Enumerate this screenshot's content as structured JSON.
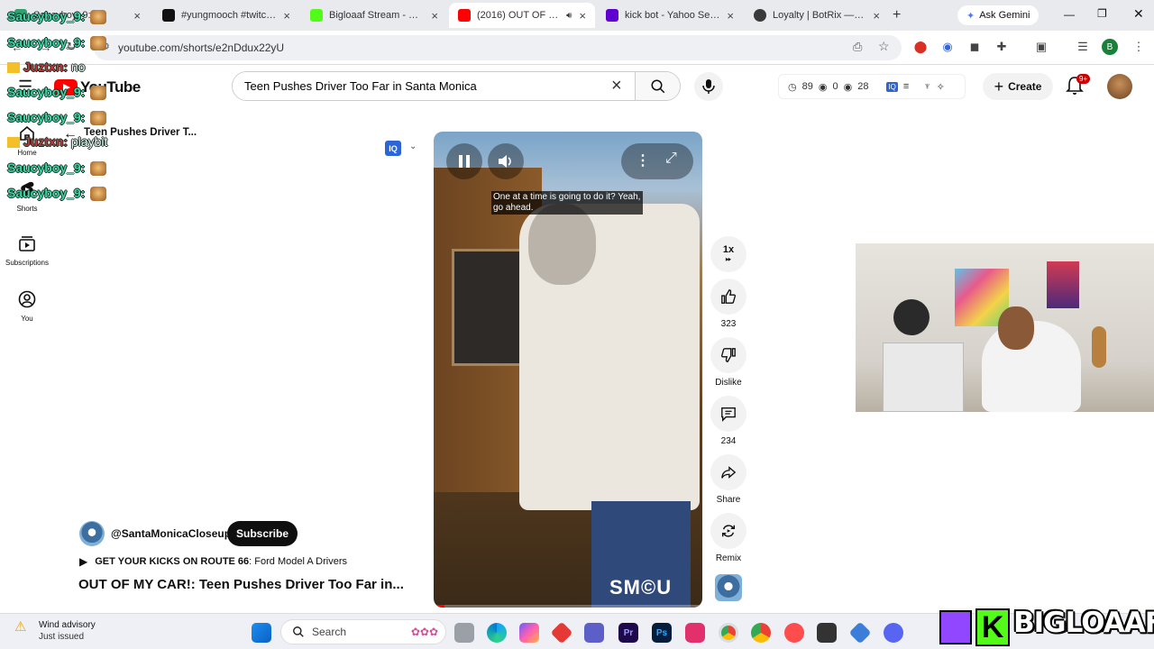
{
  "browser": {
    "tabs": [
      {
        "title": "Saucyboy_9:",
        "favicon_color": "#2fa36b",
        "close": "×"
      },
      {
        "title": "#yungmooch #twitch #",
        "favicon_color": "#111111",
        "close": "×"
      },
      {
        "title": "Bigloaaf Stream - Watch",
        "favicon_color": "#53fc18",
        "close": "×"
      },
      {
        "title": "(2016) OUT OF MY",
        "favicon_color": "#ff0000",
        "close": "×"
      },
      {
        "title": "kick bot - Yahoo Search",
        "favicon_color": "#6001d2",
        "close": "×"
      },
      {
        "title": "Loyalty | BotRix — Cloud",
        "favicon_color": "#3a3a3a",
        "close": "×"
      }
    ],
    "new_tab": "+",
    "gemini_label": "Ask Gemini",
    "url": "youtube.com/shorts/e2nDdux22yU",
    "profile_letter": "B",
    "accent_color": "#1a73e8"
  },
  "masthead": {
    "logo_text": "YouTube",
    "search_value": "Teen Pushes Driver Too Far in Santa Monica",
    "clear_icon": "×",
    "stats": {
      "views": "89",
      "eye1": "0",
      "eye2": "28"
    },
    "create_label": "Create",
    "notif_count": "9+"
  },
  "sidebar": {
    "items": [
      {
        "label": "Home"
      },
      {
        "label": "Shorts"
      },
      {
        "label": "Subscriptions"
      },
      {
        "label": "You"
      }
    ]
  },
  "shorts": {
    "back_title": "Teen Pushes Driver T...",
    "caption": "One at a time is going to do it? Yeah, go ahead.",
    "watermark": "SM©U",
    "speed_label": "1x",
    "like_count": "323",
    "dislike_label": "Dislike",
    "comment_count": "234",
    "share_label": "Share",
    "remix_label": "Remix",
    "channel": "@SantaMonicaCloseup",
    "subscribe_label": "Subscribe",
    "playlist_prefix": "GET YOUR KICKS ON ROUTE 66",
    "playlist_suffix": ": Ford Model A Drivers",
    "title": "OUT OF MY CAR!: Teen Pushes Driver Too Far in..."
  },
  "chat_overlay": [
    {
      "user": "Saucyboy_9:",
      "message": "",
      "color": "#3fd6a2"
    },
    {
      "user": "Saucyboy_9:",
      "message": "",
      "color": "#3fd6a2"
    },
    {
      "user": "Juztxn:",
      "message": "no",
      "color": "#c33b3b"
    },
    {
      "user": "Saucyboy_9:",
      "message": "",
      "color": "#3fd6a2"
    },
    {
      "user": "Saucyboy_9:",
      "message": "",
      "color": "#3fd6a2"
    },
    {
      "user": "Juztxn:",
      "message": "playbit",
      "color": "#c33b3b"
    },
    {
      "user": "Saucyboy_9:",
      "message": "",
      "color": "#3fd6a2"
    },
    {
      "user": "Saucyboy_9:",
      "message": "",
      "color": "#3fd6a2"
    }
  ],
  "taskbar": {
    "weather_title": "Wind advisory",
    "weather_sub": "Just issued",
    "search_placeholder": "Search"
  },
  "brand_overlay": {
    "text": "BIGLOAAF",
    "kick_letter": "K",
    "twitch_color": "#9146ff",
    "kick_color": "#53fc18"
  }
}
